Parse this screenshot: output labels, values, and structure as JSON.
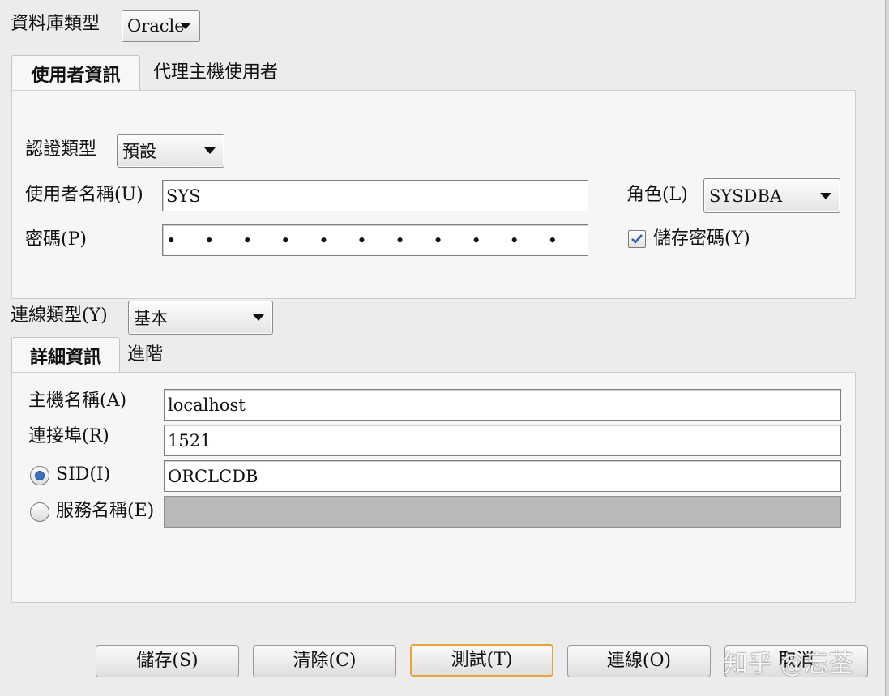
{
  "database_type": {
    "label": "資料庫類型",
    "value": "Oracle"
  },
  "top_tabs": [
    {
      "label": "使用者資訊",
      "active": true
    },
    {
      "label": "代理主機使用者",
      "active": false
    }
  ],
  "user_info": {
    "auth_type": {
      "label": "認證類型",
      "value": "預設"
    },
    "username": {
      "label": "使用者名稱(U)",
      "value": "SYS"
    },
    "password": {
      "label": "密碼(P)",
      "masked_value": "• • • • • • • • • • •"
    },
    "role": {
      "label": "角色(L)",
      "value": "SYSDBA"
    },
    "save_password": {
      "label": "儲存密碼(Y)",
      "checked": true
    }
  },
  "connection_type": {
    "label": "連線類型(Y)",
    "value": "基本"
  },
  "detail_tabs": [
    {
      "label": "詳細資訊",
      "active": true
    },
    {
      "label": "進階",
      "active": false
    }
  ],
  "details": {
    "hostname": {
      "label": "主機名稱(A)",
      "value": "localhost"
    },
    "port": {
      "label": "連接埠(R)",
      "value": "1521"
    },
    "sid": {
      "label": "SID(I)",
      "value": "ORCLCDB",
      "selected": true
    },
    "service_name": {
      "label": "服務名稱(E)",
      "value": "",
      "selected": false
    }
  },
  "buttons": {
    "save": "儲存(S)",
    "clear": "清除(C)",
    "test": "測試(T)",
    "connect": "連線(O)",
    "cancel": "取消"
  },
  "watermark": "知乎 @忘荃",
  "colors": {
    "focus_border": "#e8a43a",
    "radio_dot": "#3a6fc4",
    "check_mark": "#2f5fb0"
  }
}
